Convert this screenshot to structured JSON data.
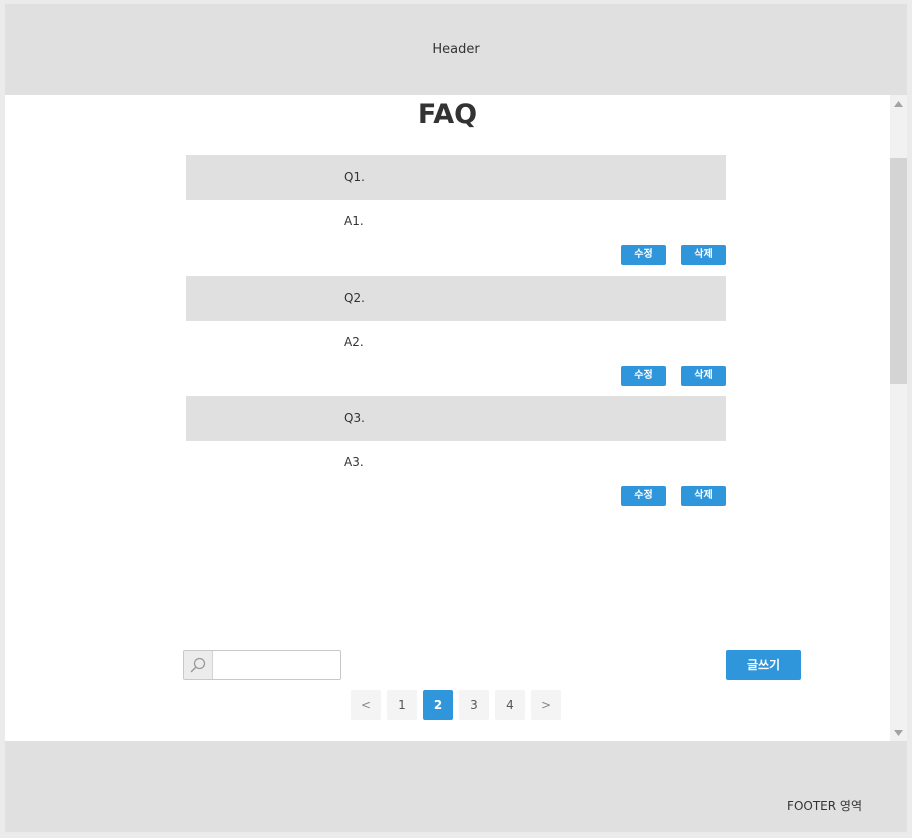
{
  "header": {
    "label": "Header"
  },
  "page": {
    "title": "FAQ"
  },
  "faq_items": [
    {
      "question": "Q1.",
      "answer": "A1.",
      "edit_label": "수정",
      "delete_label": "삭제"
    },
    {
      "question": "Q2.",
      "answer": "A2.",
      "edit_label": "수정",
      "delete_label": "삭제"
    },
    {
      "question": "Q3.",
      "answer": "A3.",
      "edit_label": "수정",
      "delete_label": "삭제"
    }
  ],
  "search": {
    "value": "",
    "placeholder": "",
    "icon": "search-icon"
  },
  "write_button": {
    "label": "글쓰기"
  },
  "pagination": {
    "prev": "<",
    "next": ">",
    "pages": [
      "1",
      "2",
      "3",
      "4"
    ],
    "current": "2"
  },
  "footer": {
    "label": "FOOTER 영역"
  },
  "colors": {
    "accent": "#2f96dc",
    "header_bg": "#e0e0e0",
    "question_bg": "#e0e0e0",
    "page_btn_bg": "#f4f4f4"
  }
}
